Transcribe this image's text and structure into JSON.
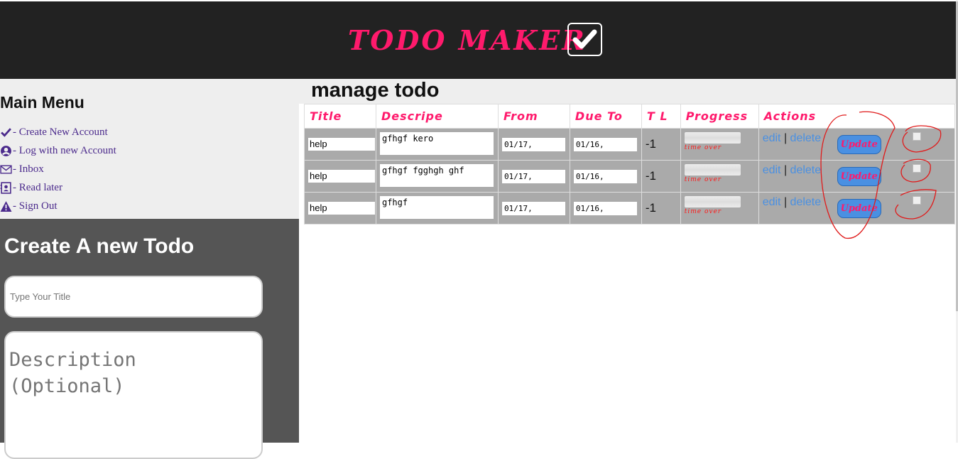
{
  "header": {
    "brand": "TODO MAKER",
    "brand_icon": "check-icon",
    "brand_color": "#ff1a6c"
  },
  "menu": {
    "title": "Main Menu",
    "items": [
      {
        "label": "- Create New Account",
        "icon": "check-icon"
      },
      {
        "label": "- Log with new Account",
        "icon": "user-circle-icon"
      },
      {
        "label": "- Inbox",
        "icon": "envelope-icon"
      },
      {
        "label": "- Read later",
        "icon": "contact-card-icon"
      },
      {
        "label": "- Sign Out",
        "icon": "warning-icon"
      }
    ]
  },
  "create": {
    "title": "Create A new Todo",
    "title_placeholder": "Type Your Title",
    "description_placeholder": "Description\n(Optional)"
  },
  "manage": {
    "title": "manage todo",
    "columns": [
      "Title",
      "Descripe",
      "From",
      "Due To",
      "T L",
      "Progress",
      "Actions"
    ],
    "rows": [
      {
        "title": "help",
        "description": "gfhgf kero",
        "from": "01/17,",
        "due": "01/16,",
        "tl": "-1",
        "progress": 0,
        "status": "time over"
      },
      {
        "title": "help",
        "description": "gfhgf fgghgh ghf",
        "from": "01/17,",
        "due": "01/16,",
        "tl": "-1",
        "progress": 0,
        "status": "time over"
      },
      {
        "title": "help",
        "description": "gfhgf",
        "from": "01/17,",
        "due": "01/16,",
        "tl": "-1",
        "progress": 0,
        "status": "time over"
      }
    ],
    "actions": {
      "edit": "edit",
      "separator": "|",
      "delete": "delete",
      "update": "Update"
    }
  }
}
